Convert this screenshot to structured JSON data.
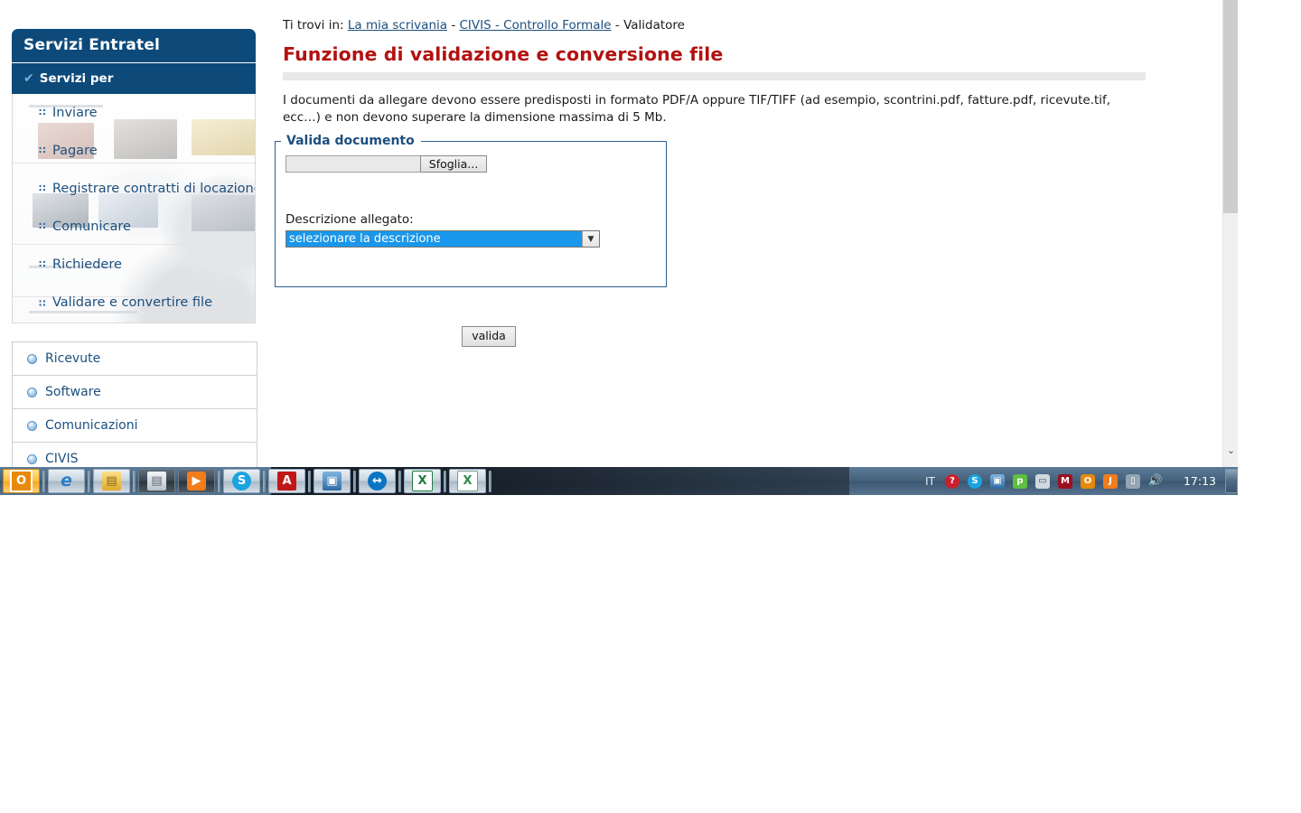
{
  "colors": {
    "brand_navy": "#0d4a7a",
    "title_red": "#b31111",
    "link_blue": "#1d4f7e",
    "select_highlight": "#1a97ea"
  },
  "sidebar": {
    "title": "Servizi Entratel",
    "subtitle": "Servizi per",
    "check_icon": "✔",
    "menu": [
      {
        "label": "Inviare",
        "bullet": "∷"
      },
      {
        "label": "Pagare",
        "bullet": "∷"
      },
      {
        "label": "Registrare contratti di locazione",
        "bullet": "∷"
      },
      {
        "label": "Comunicare",
        "bullet": "∷"
      },
      {
        "label": "Richiedere",
        "bullet": "∷"
      },
      {
        "label": "Validare e convertire file",
        "bullet": "∷"
      }
    ],
    "sections": [
      {
        "label": "Ricevute"
      },
      {
        "label": "Software"
      },
      {
        "label": "Comunicazioni"
      },
      {
        "label": "CIVIS"
      }
    ]
  },
  "breadcrumb": {
    "prefix": "Ti trovi in:",
    "link1": "La mia scrivania",
    "sep1": "-",
    "link2": "CIVIS - Controllo Formale",
    "sep2": "-",
    "current": "Validatore"
  },
  "main": {
    "page_title": "Funzione di validazione e conversione file",
    "intro": "I documenti da allegare devono essere predisposti in formato PDF/A oppure TIF/TIFF (ad esempio, scontrini.pdf, fatture.pdf, ricevute.tif, ecc…) e non devono superare la dimensione massima di 5 Mb."
  },
  "form": {
    "legend": "Valida documento",
    "file_value": "",
    "browse_label": "Sfoglia...",
    "description_label": "Descrizione allegato:",
    "description_selected": "selezionare la descrizione",
    "dropdown_arrow": "▼",
    "submit_label": "valida"
  },
  "scrollbar": {
    "down_arrow": "⌄"
  },
  "taskbar": {
    "buttons": [
      {
        "name": "office-outlook",
        "glyph": "O",
        "bg": "#e8890c",
        "state": "active"
      },
      {
        "name": "internet-explorer",
        "glyph": "e",
        "bg": "#2a7fc9",
        "state": "normal"
      },
      {
        "name": "file-explorer",
        "glyph": "▤",
        "bg": "#e8b63a",
        "state": "normal"
      },
      {
        "name": "notepad",
        "glyph": "▤",
        "bg": "#7b8794",
        "state": "dark"
      },
      {
        "name": "media-player",
        "glyph": "▶",
        "bg": "#f07c1c",
        "state": "dark"
      },
      {
        "name": "skype",
        "glyph": "S",
        "bg": "#1aa3e0",
        "state": "normal"
      },
      {
        "name": "adobe-reader",
        "glyph": "A",
        "bg": "#c01818",
        "state": "normal"
      },
      {
        "name": "folder-open",
        "glyph": "▣",
        "bg": "#2f6ca5",
        "state": "normal"
      },
      {
        "name": "teamviewer",
        "glyph": "↔",
        "bg": "#0b74c4",
        "state": "normal"
      },
      {
        "name": "excel",
        "glyph": "X",
        "bg": "#1f7a3e",
        "state": "normal"
      },
      {
        "name": "excel-document",
        "glyph": "X",
        "bg": "#2d8a4e",
        "state": "normal"
      }
    ],
    "tray": {
      "language": "IT",
      "icons": [
        {
          "name": "help-icon",
          "glyph": "?",
          "bg": "#cc1f2e"
        },
        {
          "name": "skype-tray-icon",
          "glyph": "S",
          "bg": "#1aa3e0"
        },
        {
          "name": "folder-tray-icon",
          "glyph": "▣",
          "bg": "#2f6ca5"
        },
        {
          "name": "green-app-icon",
          "glyph": "p",
          "bg": "#5fbf3f"
        },
        {
          "name": "printer-icon",
          "glyph": "▭",
          "bg": "#9fb3c4"
        },
        {
          "name": "mcafee-icon",
          "glyph": "M",
          "bg": "#9b1020"
        },
        {
          "name": "office-tray-icon",
          "glyph": "O",
          "bg": "#e8890c"
        },
        {
          "name": "java-icon",
          "glyph": "J",
          "bg": "#f07c1c"
        },
        {
          "name": "network-icon",
          "glyph": "▯",
          "bg": "#8b9aa8"
        },
        {
          "name": "volume-icon",
          "glyph": "🔊",
          "bg": "transparent"
        }
      ],
      "clock": "17:13"
    }
  }
}
